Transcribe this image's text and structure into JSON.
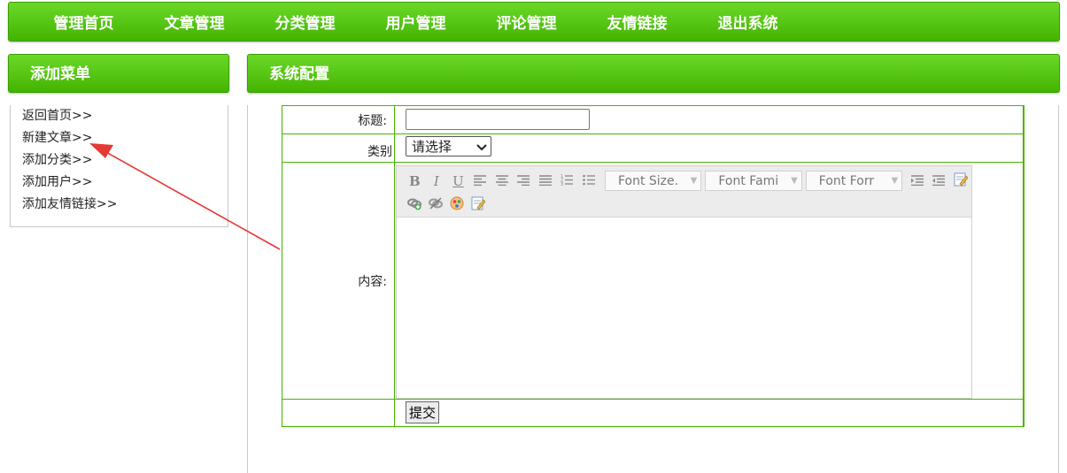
{
  "nav": {
    "items": [
      "管理首页",
      "文章管理",
      "分类管理",
      "用户管理",
      "评论管理",
      "友情链接",
      "退出系统"
    ]
  },
  "sidebar": {
    "title": "添加菜单",
    "links": [
      "返回首页>>",
      "新建文章>>",
      "添加分类>>",
      "添加用户>>",
      "添加友情链接>>"
    ]
  },
  "main": {
    "title": "系统配置",
    "form": {
      "title_label": "标题:",
      "title_value": "",
      "category_label": "类别",
      "category_selected": "请选择",
      "content_label": "内容:",
      "submit_label": "提交"
    },
    "editor": {
      "font_size_placeholder": "Font Size.",
      "font_family_placeholder": "Font Fami",
      "font_format_placeholder": "Font Forr"
    }
  },
  "annotation": {
    "arrow_color": "#e53935"
  }
}
